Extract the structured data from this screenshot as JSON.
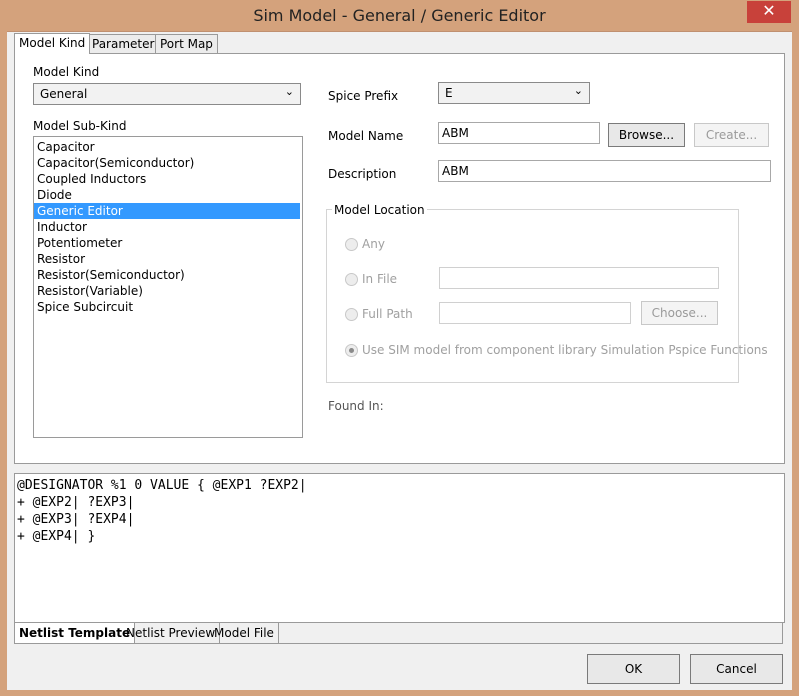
{
  "window": {
    "title": "Sim Model - General / Generic Editor",
    "close_glyph": "✕"
  },
  "tabs_top": [
    "Model Kind",
    "Parameters",
    "Port Map"
  ],
  "model_kind": {
    "label": "Model Kind",
    "value": "General"
  },
  "model_sub_kind": {
    "label": "Model Sub-Kind",
    "items": [
      "Capacitor",
      "Capacitor(Semiconductor)",
      "Coupled Inductors",
      "Diode",
      "Generic Editor",
      "Inductor",
      "Potentiometer",
      "Resistor",
      "Resistor(Semiconductor)",
      "Resistor(Variable)",
      "Spice Subcircuit"
    ],
    "selected": "Generic Editor"
  },
  "spice_prefix": {
    "label": "Spice Prefix",
    "value": "E"
  },
  "model_name": {
    "label": "Model Name",
    "value": "ABM",
    "browse": "Browse...",
    "create": "Create..."
  },
  "description": {
    "label": "Description",
    "value": "ABM"
  },
  "model_location": {
    "title": "Model Location",
    "any": "Any",
    "in_file": "In File",
    "full_path": "Full Path",
    "choose": "Choose...",
    "use_sim": "Use SIM model from component library Simulation Pspice Functions"
  },
  "found_in": "Found In:",
  "netlist_template": [
    "@DESIGNATOR %1 0 VALUE { @EXP1 ?EXP2|",
    "+ @EXP2| ?EXP3|",
    "+ @EXP3| ?EXP4|",
    "+ @EXP4| }"
  ],
  "tabs_bottom": [
    "Netlist Template",
    "Netlist Preview",
    "Model File"
  ],
  "buttons": {
    "ok": "OK",
    "cancel": "Cancel"
  },
  "colors": {
    "frame": "#d4a27c",
    "close": "#c8413a",
    "selection": "#3399ff"
  }
}
